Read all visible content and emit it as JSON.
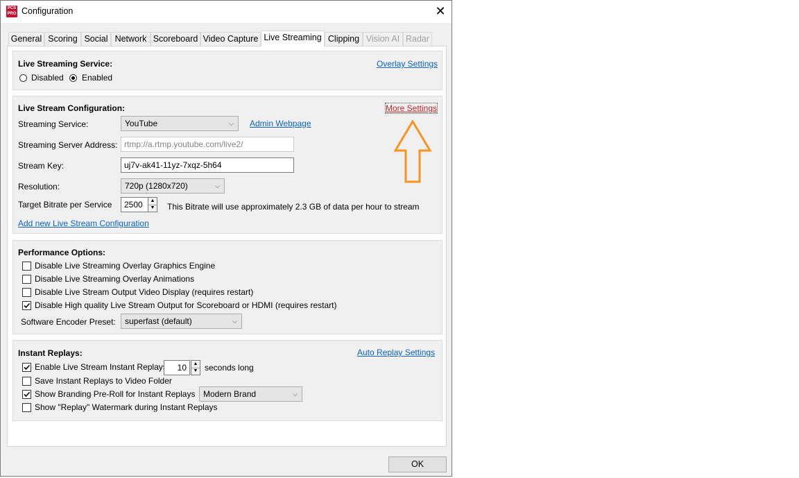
{
  "window": {
    "title": "Configuration",
    "app_icon_text_top": "PCS",
    "app_icon_text_bottom": "PRO",
    "close_glyph": "✕"
  },
  "tabs": [
    {
      "label": "General",
      "state": "normal"
    },
    {
      "label": "Scoring",
      "state": "normal"
    },
    {
      "label": "Social",
      "state": "normal"
    },
    {
      "label": "Network",
      "state": "normal"
    },
    {
      "label": "Scoreboard",
      "state": "normal"
    },
    {
      "label": "Video Capture",
      "state": "normal"
    },
    {
      "label": "Live Streaming",
      "state": "active"
    },
    {
      "label": "Clipping",
      "state": "normal"
    },
    {
      "label": "Vision AI",
      "state": "disabled"
    },
    {
      "label": "Radar",
      "state": "disabled"
    }
  ],
  "service": {
    "heading": "Live Streaming Service:",
    "overlay_link": "Overlay Settings",
    "disabled_label": "Disabled",
    "enabled_label": "Enabled",
    "selected": "Enabled"
  },
  "config": {
    "heading": "Live Stream Configuration:",
    "more_settings_link": "More Settings",
    "streaming_service_label": "Streaming Service:",
    "streaming_service_value": "YouTube",
    "admin_link": "Admin Webpage",
    "server_address_label": "Streaming Server Address:",
    "server_address_value": "rtmp://a.rtmp.youtube.com/live2/",
    "stream_key_label": "Stream Key:",
    "stream_key_value": "uj7v-ak41-11yz-7xqz-5h64",
    "resolution_label": "Resolution:",
    "resolution_value": "720p (1280x720)",
    "bitrate_label": "Target Bitrate per Service",
    "bitrate_value": "2500",
    "bitrate_note": "This Bitrate will use approximately 2.3 GB of data per hour to stream",
    "add_link": "Add new Live Stream Configuration"
  },
  "performance": {
    "heading": "Performance Options:",
    "options": [
      {
        "label": "Disable Live Streaming Overlay Graphics Engine",
        "checked": false
      },
      {
        "label": "Disable Live Streaming Overlay Animations",
        "checked": false
      },
      {
        "label": "Disable Live Stream Output Video Display (requires restart)",
        "checked": false
      },
      {
        "label": "Disable High quality Live Stream Output for Scoreboard or HDMI (requires restart)",
        "checked": true
      }
    ],
    "encoder_label": "Software Encoder Preset:",
    "encoder_value": "superfast (default)"
  },
  "replays": {
    "heading": "Instant Replays:",
    "auto_link": "Auto Replay Settings",
    "enable_label": "Enable Live Stream Instant Replays",
    "enable_checked": true,
    "seconds_value": "10",
    "seconds_suffix": "seconds long",
    "save_label": "Save Instant Replays to Video Folder",
    "save_checked": false,
    "branding_label": "Show Branding Pre-Roll for Instant Replays",
    "branding_checked": true,
    "branding_value": "Modern Brand",
    "watermark_label": "Show \"Replay\" Watermark during Instant Replays",
    "watermark_checked": false
  },
  "footer": {
    "ok_label": "OK"
  },
  "colors": {
    "link": "#0b63c5",
    "highlight_link": "#c0282d",
    "annotation_arrow": "#f7941d"
  }
}
